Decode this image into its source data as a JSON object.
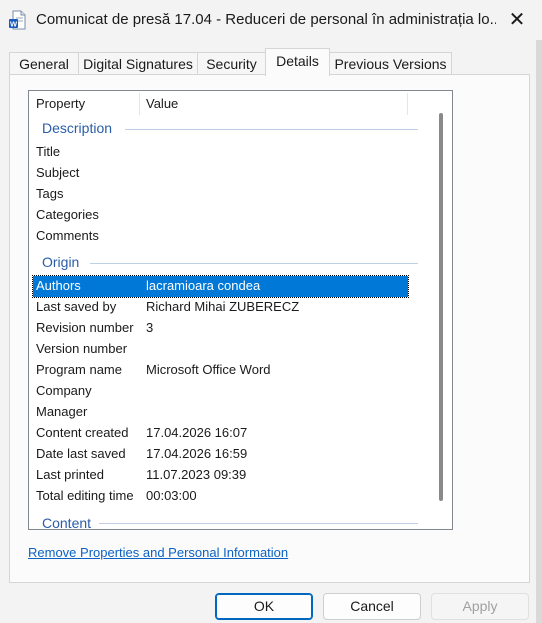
{
  "window": {
    "title": "Comunicat de presă 17.04 - Reduceri de personal în administrația lo...",
    "close_glyph": "✕"
  },
  "tabs": [
    {
      "label": "General"
    },
    {
      "label": "Digital Signatures"
    },
    {
      "label": "Security"
    },
    {
      "label": "Details",
      "active": true
    },
    {
      "label": "Previous Versions"
    }
  ],
  "details": {
    "columns": {
      "property": "Property",
      "value": "Value"
    },
    "groups": {
      "description": "Description",
      "origin": "Origin",
      "content": "Content"
    },
    "description_rows": [
      {
        "name": "Title",
        "value": ""
      },
      {
        "name": "Subject",
        "value": ""
      },
      {
        "name": "Tags",
        "value": ""
      },
      {
        "name": "Categories",
        "value": ""
      },
      {
        "name": "Comments",
        "value": ""
      }
    ],
    "origin_rows": [
      {
        "name": "Authors",
        "value": "lacramioara condea",
        "selected": true
      },
      {
        "name": "Last saved by",
        "value": "Richard Mihai ZUBERECZ"
      },
      {
        "name": "Revision number",
        "value": "3"
      },
      {
        "name": "Version number",
        "value": ""
      },
      {
        "name": "Program name",
        "value": "Microsoft Office Word"
      },
      {
        "name": "Company",
        "value": ""
      },
      {
        "name": "Manager",
        "value": ""
      },
      {
        "name": "Content created",
        "value": "17.04.2026 16:07"
      },
      {
        "name": "Date last saved",
        "value": "17.04.2026 16:59"
      },
      {
        "name": "Last printed",
        "value": "11.07.2023 09:39"
      },
      {
        "name": "Total editing time",
        "value": "00:03:00"
      }
    ]
  },
  "remove_link": "Remove Properties and Personal Information",
  "buttons": {
    "ok": "OK",
    "cancel": "Cancel",
    "apply": "Apply"
  },
  "colors": {
    "accent": "#0078d7",
    "group_heading": "#2a5da8",
    "link": "#0b62c4"
  }
}
